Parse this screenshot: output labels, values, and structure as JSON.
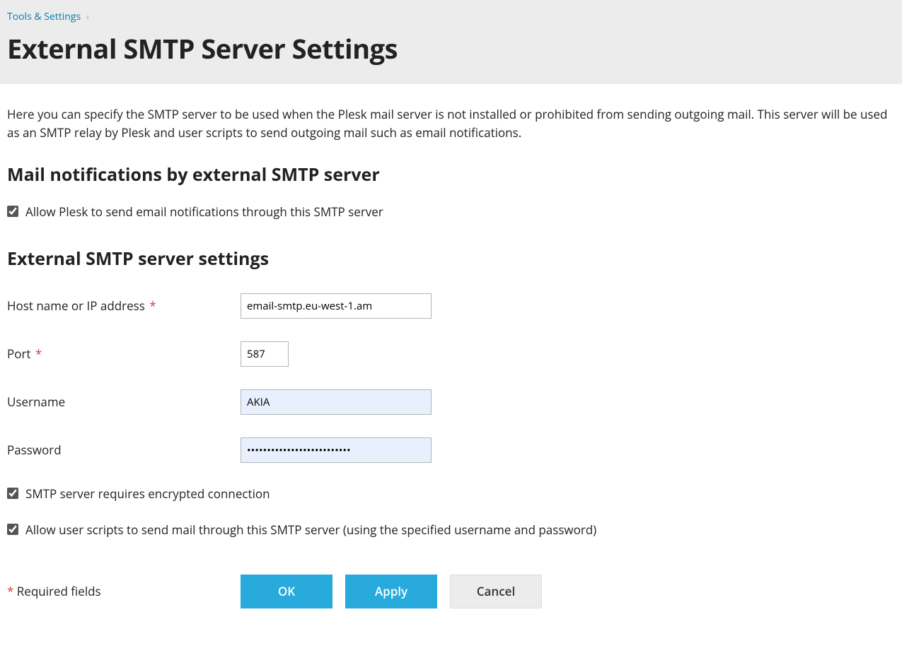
{
  "breadcrumb": {
    "parent": "Tools & Settings"
  },
  "page_title": "External SMTP Server Settings",
  "description": "Here you can specify the SMTP server to be used when the Plesk mail server is not installed or prohibited from sending outgoing mail. This server will be used as an SMTP relay by Plesk and user scripts to send outgoing mail such as email notifications.",
  "section1": {
    "heading": "Mail notifications by external SMTP server",
    "allow_notifications_label": "Allow Plesk to send email notifications through this SMTP server",
    "allow_notifications_checked": true
  },
  "section2": {
    "heading": "External SMTP server settings",
    "host_label": "Host name or IP address",
    "host_value": "email-smtp.eu-west-1.am",
    "port_label": "Port",
    "port_value": "587",
    "username_label": "Username",
    "username_value": "AKIA",
    "password_label": "Password",
    "password_value": "••••••••••••••••••••••••••",
    "encrypted_label": "SMTP server requires encrypted connection",
    "encrypted_checked": true,
    "allow_scripts_label": "Allow user scripts to send mail through this SMTP server (using the specified username and password)",
    "allow_scripts_checked": true
  },
  "footer": {
    "required_note": "Required fields",
    "ok_label": "OK",
    "apply_label": "Apply",
    "cancel_label": "Cancel"
  }
}
